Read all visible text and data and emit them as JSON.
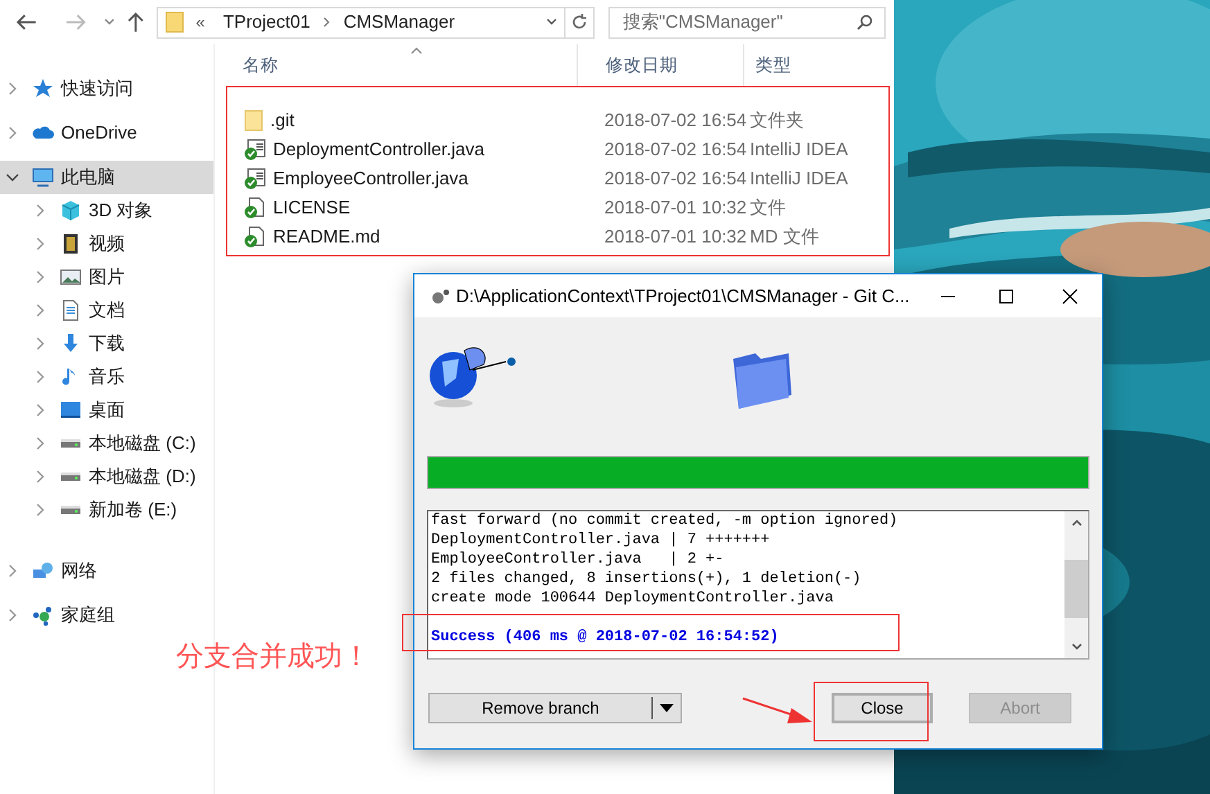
{
  "address": {
    "overflow": "«",
    "path": [
      "TProject01",
      "CMSManager"
    ]
  },
  "search": {
    "placeholder": "搜索\"CMSManager\""
  },
  "sidebar": [
    {
      "label": "快速访问",
      "kind": "star",
      "selected": false,
      "expanded": false
    },
    {
      "label": "OneDrive",
      "kind": "cloud",
      "selected": false,
      "expanded": false
    },
    {
      "label": "此电脑",
      "kind": "pc",
      "selected": true,
      "expanded": true,
      "children": [
        {
          "label": "3D 对象",
          "kind": "cube",
          "selected": false,
          "expanded": false
        },
        {
          "label": "视频",
          "kind": "film",
          "selected": false,
          "expanded": false
        },
        {
          "label": "图片",
          "selected": false,
          "expanded": false
        },
        {
          "label": "文档",
          "kind": "doc",
          "selected": false,
          "expanded": false
        },
        {
          "label": "下载",
          "kind": "download",
          "selected": false,
          "expanded": false
        },
        {
          "label": "音乐",
          "kind": "music",
          "selected": false,
          "expanded": false
        },
        {
          "label": "桌面",
          "kind": "desktop",
          "selected": false,
          "expanded": false
        },
        {
          "label": "本地磁盘 (C:)",
          "kind": "drive",
          "selected": false,
          "expanded": false
        },
        {
          "label": "本地磁盘 (D:)",
          "kind": "drive",
          "selected": false,
          "expanded": false
        },
        {
          "label": "新加卷 (E:)",
          "kind": "drive",
          "selected": false,
          "expanded": false
        }
      ]
    },
    {
      "label": "网络",
      "kind": "network",
      "selected": false,
      "expanded": false
    },
    {
      "label": "家庭组",
      "kind": "homegroup",
      "selected": false,
      "expanded": false
    }
  ],
  "columns": [
    "名称",
    "修改日期",
    "类型"
  ],
  "files": [
    {
      "name": ".git",
      "date": "2018-07-02 16:54",
      "type": "文件夹",
      "kind": "folder"
    },
    {
      "name": "DeploymentController.java",
      "date": "2018-07-02 16:54",
      "type": "IntelliJ IDEA",
      "kind": "java"
    },
    {
      "name": "EmployeeController.java",
      "date": "2018-07-02 16:54",
      "type": "IntelliJ IDEA",
      "kind": "java"
    },
    {
      "name": "LICENSE",
      "date": "2018-07-01 10:32",
      "type": "文件",
      "kind": "file"
    },
    {
      "name": "README.md",
      "date": "2018-07-01 10:32",
      "type": "MD 文件",
      "kind": "file"
    }
  ],
  "dialog": {
    "title": "D:\\ApplicationContext\\TProject01\\CMSManager - Git C...",
    "progress": {
      "level": 1
    },
    "log": [
      {
        "text": "fast forward (no commit created, -m option ignored)",
        "kind": "normal"
      },
      {
        "text": "DeploymentController.java | 7 +++++++",
        "kind": "normal"
      },
      {
        "text": "EmployeeController.java   | 2 +-",
        "kind": "normal"
      },
      {
        "text": "2 files changed, 8 insertions(+), 1 deletion(-)",
        "kind": "normal"
      },
      {
        "text": "create mode 100644 DeploymentController.java",
        "kind": "normal"
      },
      {
        "text": "Success (406 ms @ 2018-07-02 16:54:52)",
        "kind": "success"
      }
    ],
    "buttons": [
      {
        "label": "Remove branch",
        "kind": "split",
        "selected": false,
        "disabled": false
      },
      {
        "label": "Close",
        "kind": "plain",
        "selected": true,
        "disabled": false
      },
      {
        "label": "Abort",
        "kind": "plain",
        "selected": false,
        "disabled": true
      }
    ]
  },
  "annotation": {
    "text": "分支合并成功！"
  }
}
